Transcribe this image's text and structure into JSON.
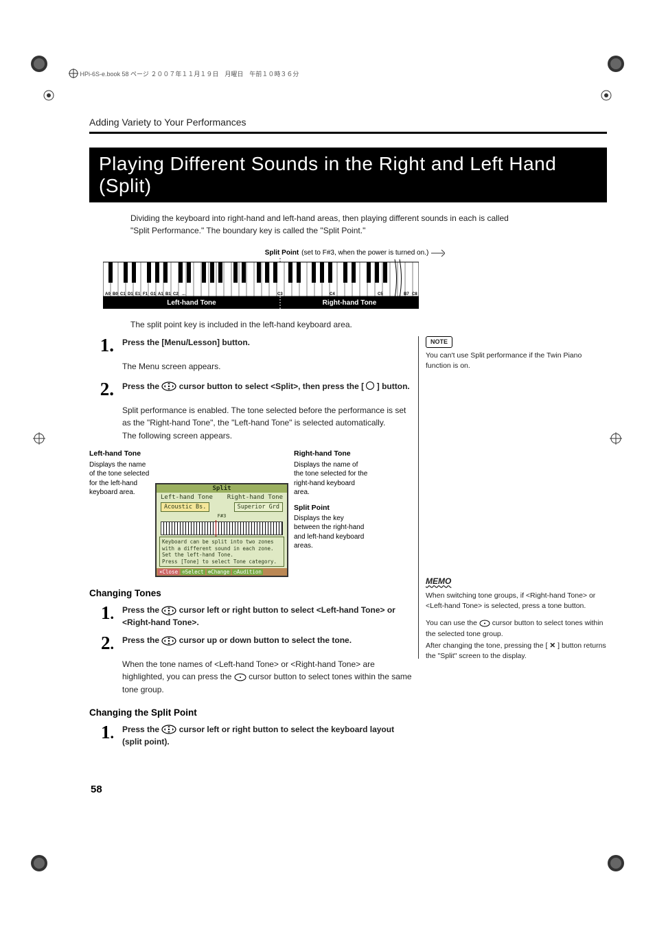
{
  "header_line": "HPi-6S-e.book  58 ページ  ２００７年１１月１９日　月曜日　午前１０時３６分",
  "breadcrumb": "Adding Variety to Your Performances",
  "title": "Playing Different Sounds in the Right and Left Hand (Split)",
  "intro": "Dividing the keyboard into right-hand and left-hand areas, then playing different sounds in each is called \"Split Performance.\" The boundary key is called the \"Split Point.\"",
  "fig": {
    "split_point_label_bold": "Split Point",
    "split_point_label_rest": " (set to F#3, when the power is turned on.)",
    "keys": [
      "A0",
      "B0",
      "C1",
      "D1",
      "E1",
      "F1",
      "G1",
      "A1",
      "B1",
      "C2",
      "...",
      "C3",
      "C4",
      "C5",
      "B7",
      "C8"
    ],
    "left_zone": "Left-hand Tone",
    "right_zone": "Right-hand Tone"
  },
  "after_fig": "The split point key is included in the left-hand keyboard area.",
  "steps": [
    {
      "num": "1.",
      "body_bold": "Press the [Menu/Lesson] button.",
      "sub": "The Menu screen appears."
    },
    {
      "num": "2.",
      "body_before": "Press the ",
      "body_after_icon": " cursor button to select <Split>, then press the [ ",
      "body_after_circle": " ] button.",
      "sub": "Split performance is enabled. The tone selected before the performance is set as the \"Right-hand Tone\", the \"Left-hand Tone\" is selected automatically.\nThe following screen appears."
    }
  ],
  "annot_left": {
    "hdr": "Left-hand Tone",
    "txt": "Displays the name of the tone selected for the left-hand keyboard area."
  },
  "annot_right_tone": {
    "hdr": "Right-hand Tone",
    "txt": "Displays the name of the tone selected for the right-hand keyboard area."
  },
  "annot_split_point": {
    "hdr": "Split Point",
    "txt": "Displays the key between the right-hand and left-hand keyboard areas."
  },
  "lcd": {
    "title": "Split",
    "left_label": "Left-hand Tone",
    "right_label": "Right-hand Tone",
    "left_val": "Acoustic Bs.",
    "right_val": "Superior Grd",
    "sp": "F#3",
    "msg1": "Keyboard can be split into two zones",
    "msg2": "with a different sound in each zone.",
    "msg3": "Set the left-hand Tone.",
    "msg4": "Press [Tone] to select Tone category.",
    "b1": "×Close",
    "b2": "⊙Select",
    "b3": "⊕Change",
    "b4": "○Audition"
  },
  "changing_tones": {
    "hdr": "Changing Tones",
    "s1_before": "Press the ",
    "s1_after": " cursor left or right button to select <Left-hand Tone> or <Right-hand Tone>.",
    "s2_before": "Press the ",
    "s2_after": " cursor up or down button to select the tone.",
    "s2_sub_before": "When the tone names of <Left-hand Tone> or <Right-hand Tone> are highlighted, you can press the ",
    "s2_sub_after": " cursor button to select tones within the same tone group."
  },
  "changing_split": {
    "hdr": "Changing the Split Point",
    "s1_before": "Press the ",
    "s1_after": " cursor left or right button to select the keyboard layout (split point)."
  },
  "side_note": {
    "label": "NOTE",
    "txt": "You can't use Split performance if the Twin Piano function is on."
  },
  "side_memo": {
    "label": "MEMO",
    "p1": "When switching tone groups, if <Right-hand Tone> or <Left-hand Tone> is selected, press a tone button.",
    "p2_before": "You can use the ",
    "p2_after": " cursor button to select tones within the selected tone group.",
    "p3_before": "After changing the tone, pressing the [ ",
    "p3_after": " ] button returns the \"Split\" screen to the display."
  },
  "page_num": "58"
}
